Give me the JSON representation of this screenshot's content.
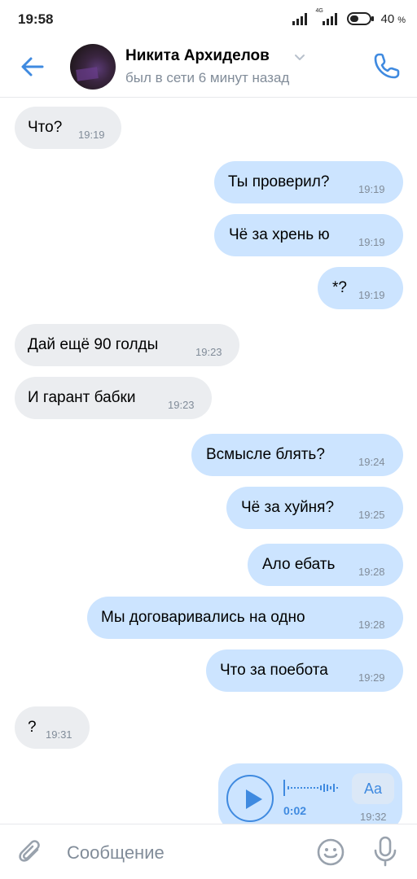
{
  "status_bar": {
    "time": "19:58",
    "network": "4G",
    "battery": "40",
    "battery_unit": "%"
  },
  "header": {
    "name": "Никита Архиделов",
    "status": "был в сети 6 минут назад"
  },
  "messages": [
    {
      "dir": "in",
      "text": "Что?",
      "time": "19:19"
    },
    {
      "dir": "out",
      "text": "Ты проверил?",
      "time": "19:19"
    },
    {
      "dir": "out",
      "text": "Чё за хрень ю",
      "time": "19:19"
    },
    {
      "dir": "out",
      "text": "*?",
      "time": "19:19"
    },
    {
      "dir": "in",
      "text": "Дай ещё 90 голды",
      "time": "19:23"
    },
    {
      "dir": "in",
      "text": "И гарант бабки",
      "time": "19:23"
    },
    {
      "dir": "out",
      "text": "Всмысле блять?",
      "time": "19:24"
    },
    {
      "dir": "out",
      "text": "Чё за хуйня?",
      "time": "19:25"
    },
    {
      "dir": "out",
      "text": "Ало ебать",
      "time": "19:28"
    },
    {
      "dir": "out",
      "text": "Мы договаривались на одно",
      "time": "19:28"
    },
    {
      "dir": "out",
      "text": "Что за поебота",
      "time": "19:29"
    },
    {
      "dir": "in",
      "text": "?",
      "time": "19:31"
    }
  ],
  "voice_message": {
    "duration": "0:02",
    "transcribe_label": "Aa",
    "time": "19:32"
  },
  "composer": {
    "placeholder": "Сообщение"
  },
  "colors": {
    "accent": "#3f8ae0",
    "incoming_bubble": "#ebedf0",
    "outgoing_bubble": "#cce4ff",
    "secondary_text": "#818c99"
  }
}
